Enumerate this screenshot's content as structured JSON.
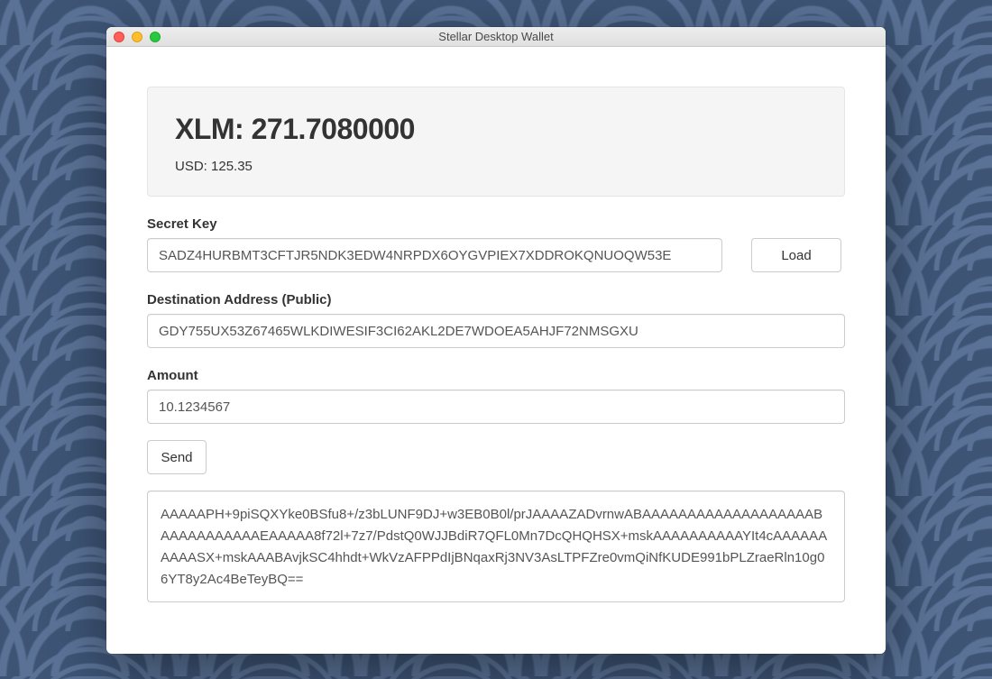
{
  "window": {
    "title": "Stellar Desktop Wallet"
  },
  "balance": {
    "main": "XLM: 271.7080000",
    "sub": "USD: 125.35"
  },
  "form": {
    "secret_key": {
      "label": "Secret Key",
      "value": "SADZ4HURBMT3CFTJR5NDK3EDW4NRPDX6OYGVPIEX7XDDROKQNUOQW53E"
    },
    "load_button": "Load",
    "destination": {
      "label": "Destination Address (Public)",
      "value": "GDY755UX53Z67465WLKDIWESIF3CI62AKL2DE7WDOEA5AHJF72NMSGXU"
    },
    "amount": {
      "label": "Amount",
      "value": "10.1234567"
    },
    "send_button": "Send",
    "output": "AAAAAPH+9piSQXYke0BSfu8+/z3bLUNF9DJ+w3EB0B0l/prJAAAAZADvrnwABAAAAAAAAAAAAAAAAAAABAAAAAAAAAAAEAAAAA8f72l+7z7/PdstQ0WJJBdiR7QFL0Mn7DcQHQHSX+mskAAAAAAAAAAYIt4cAAAAAAAAAASX+mskAAABAvjkSC4hhdt+WkVzAFPPdIjBNqaxRj3NV3AsLTPFZre0vmQiNfKUDE991bPLZraeRln10g06YT8y2Ac4BeTeyBQ=="
  }
}
